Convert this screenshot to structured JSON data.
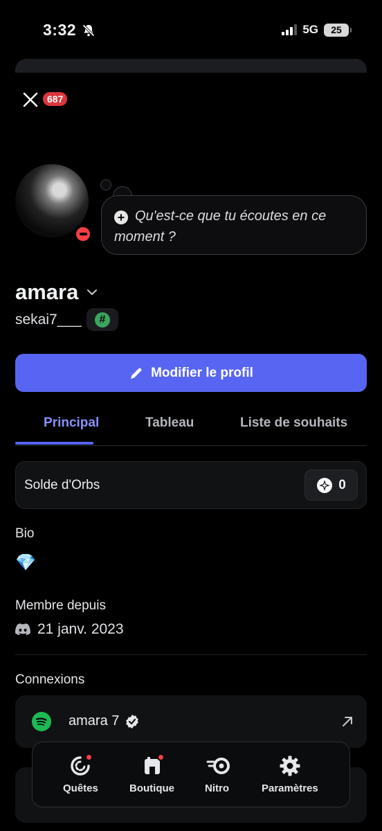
{
  "status_bar": {
    "time": "3:32",
    "network": "5G",
    "battery": "25"
  },
  "header": {
    "notification_count": "687"
  },
  "status_bubble": {
    "text": "Qu'est-ce que tu écoutes en ce moment ?"
  },
  "profile": {
    "display_name": "amara",
    "username": "sekai7___",
    "badge_symbol": "#",
    "edit_button": "Modifier le profil"
  },
  "tabs": [
    "Principal",
    "Tableau",
    "Liste de souhaits"
  ],
  "orbs": {
    "label": "Solde d'Orbs",
    "value": "0"
  },
  "bio": {
    "title": "Bio",
    "content": "💎"
  },
  "member_since": {
    "title": "Membre depuis",
    "date": "21 janv. 2023"
  },
  "connections": {
    "title": "Connexions",
    "items": [
      {
        "service": "spotify",
        "name": "amara 7",
        "verified": true
      }
    ]
  },
  "bottom_nav": {
    "items": [
      {
        "label": "Quêtes",
        "icon": "quests-icon",
        "notification": true
      },
      {
        "label": "Boutique",
        "icon": "shop-icon",
        "notification": true
      },
      {
        "label": "Nitro",
        "icon": "nitro-icon",
        "notification": false
      },
      {
        "label": "Paramètres",
        "icon": "gear-icon",
        "notification": false
      }
    ]
  },
  "colors": {
    "accent": "#5865f2",
    "dnd": "#f23f43",
    "spotify": "#1db954",
    "badge": "#da373c"
  }
}
